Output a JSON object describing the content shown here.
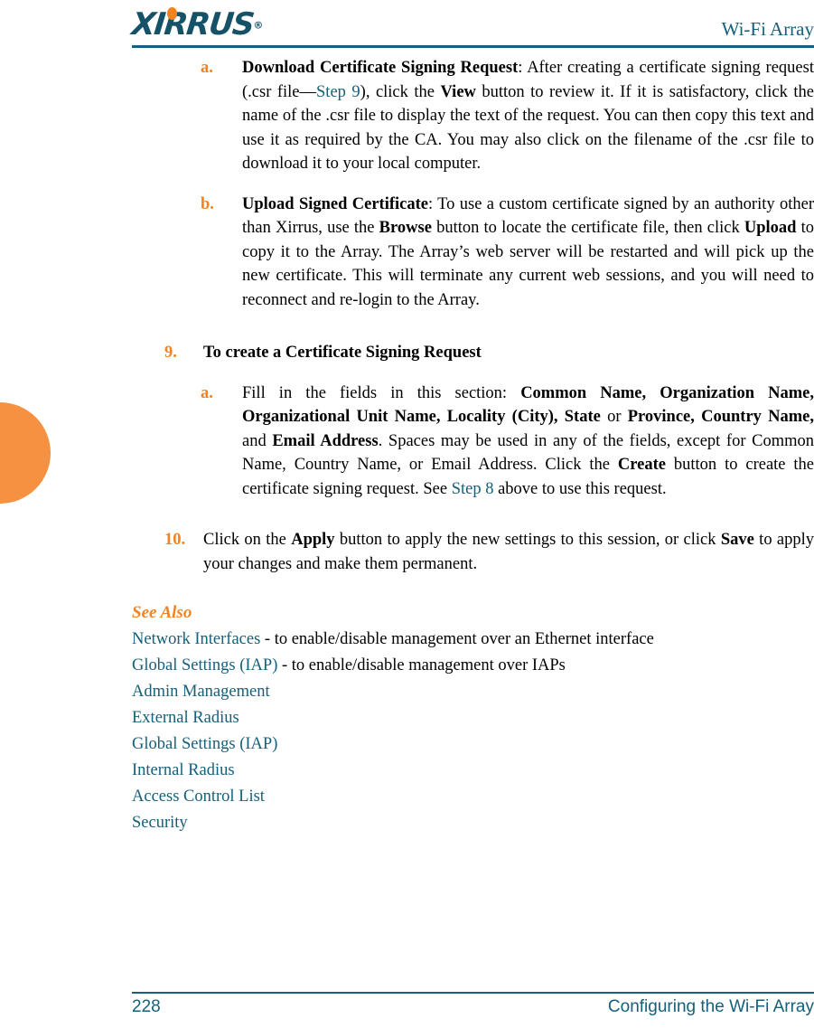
{
  "header": {
    "logo_text": "XIRRUS",
    "logo_registered": "®",
    "title": "Wi-Fi Array"
  },
  "colors": {
    "accent_orange": "#F58220",
    "edge_tab_orange": "#F59140",
    "teal": "#15607A",
    "logo_teal": "#155268",
    "body_text": "#000000"
  },
  "content": {
    "items": [
      {
        "level": 2,
        "marker": "a.",
        "lead_bold": "Download Certificate Signing Request",
        "text_1": ": After creating a certificate signing request (.csr file—",
        "link_1": "Step 9",
        "text_2": "), click the ",
        "bold_1": "View",
        "text_3": " button to review it. If it is satisfactory, click the name of the .csr file to display the text of the request. You can then copy this text and use it as required by the CA. You may also click on the filename of the .csr file to download it to your local computer."
      },
      {
        "level": 2,
        "marker": "b.",
        "lead_bold": "Upload Signed Certificate",
        "text_1": ": To use a custom certificate signed by an authority other than Xirrus, use the ",
        "bold_1": "Browse",
        "text_2": " button to locate the certificate file, then click ",
        "bold_2": "Upload",
        "text_3": " to copy it to the Array. The Array’s web server will be restarted and will pick up the new certificate. This will terminate any current web sessions, and you will need to reconnect and re-login to the Array."
      },
      {
        "level": 1,
        "marker": "9.",
        "heading": "To create a Certificate Signing Request"
      },
      {
        "level": 2,
        "marker": "a.",
        "text_1": "Fill in the fields in this section: ",
        "bold_1": "Common Name, Organization Name, Organizational Unit Name, Locality (City), State",
        "text_2": " or ",
        "bold_2": "Province, Country Name,",
        "text_3": " and ",
        "bold_3": "Email Address",
        "text_4": ". Spaces may be used in any of the fields, except for Common Name, Country Name, or Email Address. Click the ",
        "bold_4": "Create",
        "text_5": " button to create the certificate signing request. See ",
        "link_1": "Step 8",
        "text_6": " above to use this request."
      },
      {
        "level": 1,
        "marker": "10.",
        "text_1": "Click on the ",
        "bold_1": "Apply",
        "text_2": " button to apply the new settings to this session, or click ",
        "bold_2": "Save",
        "text_3": " to apply your changes and make them permanent."
      }
    ]
  },
  "see_also": {
    "title": "See Also",
    "links": [
      {
        "label": "Network Interfaces",
        "suffix": " - to enable/disable management over an Ethernet interface"
      },
      {
        "label": "Global Settings (IAP)",
        "suffix": " - to enable/disable management over IAPs"
      },
      {
        "label": "Admin Management",
        "suffix": ""
      },
      {
        "label": "External Radius",
        "suffix": ""
      },
      {
        "label": "Global Settings (IAP)",
        "suffix": ""
      },
      {
        "label": "Internal Radius",
        "suffix": ""
      },
      {
        "label": "Access Control List",
        "suffix": ""
      },
      {
        "label": "Security",
        "suffix": ""
      }
    ]
  },
  "footer": {
    "page_number": "228",
    "section_title": "Configuring the Wi-Fi Array"
  }
}
